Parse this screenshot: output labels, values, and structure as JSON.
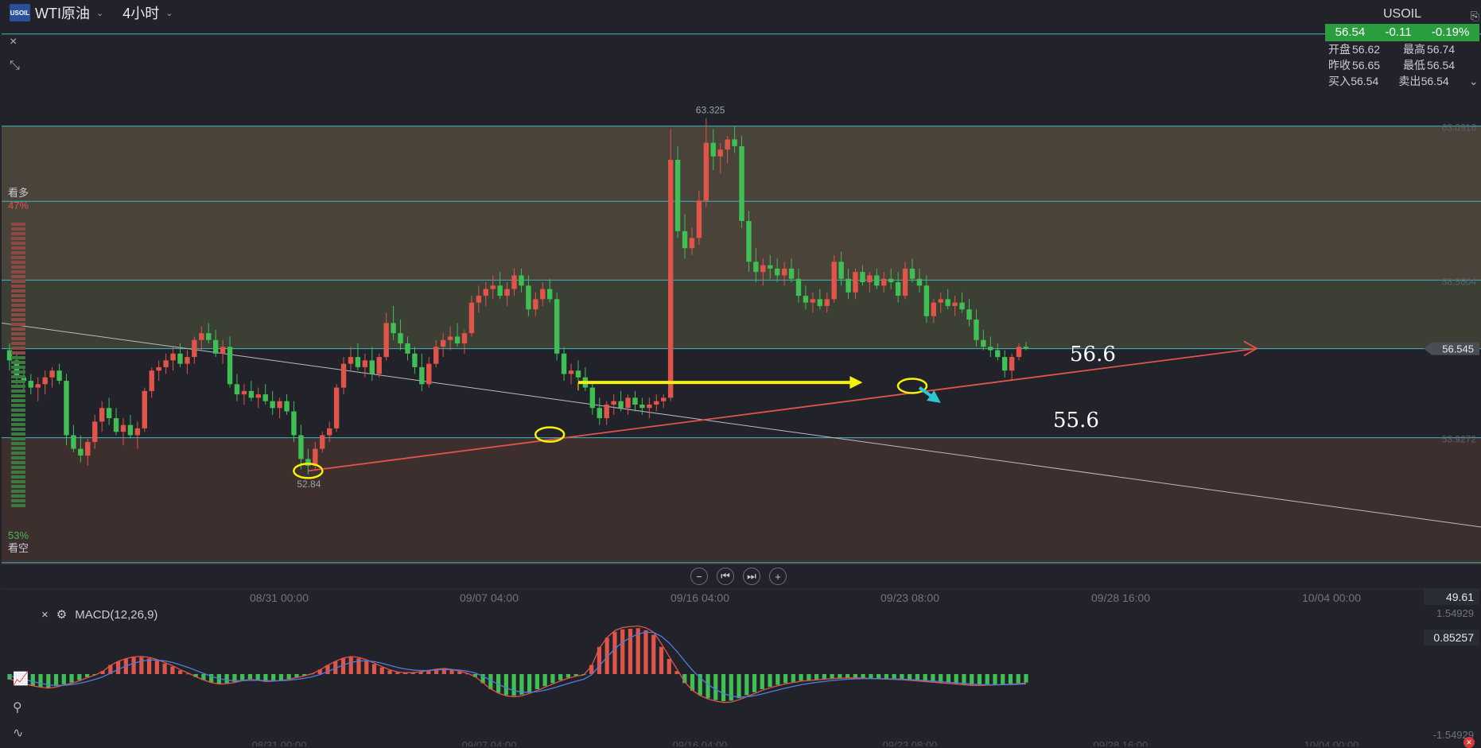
{
  "header": {
    "logo_text": "USOIL",
    "symbol": "WTI原油",
    "timeframe": "4小时",
    "close_icon": "×",
    "collapse_icon": "⤡"
  },
  "quote": {
    "title": "USOIL",
    "price": "56.54",
    "change": "-0.11",
    "change_pct": "-0.19%",
    "open_label": "开盘",
    "open": "56.62",
    "high_label": "最高",
    "high": "56.74",
    "prev_label": "昨收",
    "prev": "56.65",
    "low_label": "最低",
    "low": "56.54",
    "bid_label": "买入",
    "bid": "56.54",
    "ask_label": "卖出",
    "ask": "56.54",
    "expand_icon": "⌄",
    "accent_green": "#2a9d3f"
  },
  "sentiment": {
    "bull_label": "看多",
    "bull_pct": "47%",
    "bear_label": "看空",
    "bear_pct": "53%"
  },
  "chart_data": {
    "type": "candlestick",
    "timeframe": "4h",
    "x_labels": [
      "08/31 00:00",
      "09/07 04:00",
      "09/16 04:00",
      "09/23 08:00",
      "09/28 16:00",
      "10/04 00:00"
    ],
    "price_labels": [
      "63.0916",
      "58.5604",
      "56.545",
      "53.9272"
    ],
    "current_price": "56.545",
    "high_marker": "63.325",
    "low_marker": "52.84",
    "annotations": [
      "56.6",
      "55.6"
    ],
    "zones": [
      {
        "from": 58.5604,
        "to": 63.0916,
        "color": "#4a4339"
      },
      {
        "from": 56.545,
        "to": 58.5604,
        "color": "#3b3f34"
      },
      {
        "from": 50.2,
        "to": 53.9272,
        "color": "#3e2f2f"
      }
    ],
    "ylim": [
      50.2,
      66.8
    ],
    "candles": [
      [
        56.5,
        56.7,
        55.9,
        56.2
      ],
      [
        56.2,
        56.4,
        55.5,
        55.7
      ],
      [
        55.7,
        56.0,
        55.3,
        55.6
      ],
      [
        55.6,
        55.8,
        55.2,
        55.4
      ],
      [
        55.4,
        55.7,
        55.0,
        55.5
      ],
      [
        55.5,
        55.9,
        55.2,
        55.7
      ],
      [
        55.7,
        56.0,
        55.4,
        55.9
      ],
      [
        55.9,
        56.1,
        55.5,
        55.6
      ],
      [
        55.6,
        55.8,
        53.7,
        54.0
      ],
      [
        54.0,
        54.3,
        53.5,
        53.6
      ],
      [
        53.6,
        54.0,
        53.2,
        53.4
      ],
      [
        53.4,
        53.9,
        53.1,
        53.8
      ],
      [
        53.8,
        54.6,
        53.6,
        54.4
      ],
      [
        54.4,
        55.0,
        54.1,
        54.8
      ],
      [
        54.8,
        55.1,
        54.3,
        54.5
      ],
      [
        54.5,
        54.8,
        54.0,
        54.1
      ],
      [
        54.1,
        54.5,
        53.7,
        54.3
      ],
      [
        54.3,
        54.6,
        53.9,
        54.0
      ],
      [
        54.0,
        54.4,
        53.6,
        54.2
      ],
      [
        54.2,
        55.4,
        54.1,
        55.3
      ],
      [
        55.3,
        56.0,
        55.1,
        55.9
      ],
      [
        55.9,
        56.2,
        55.6,
        56.0
      ],
      [
        56.0,
        56.4,
        55.8,
        56.2
      ],
      [
        56.2,
        56.6,
        55.9,
        56.4
      ],
      [
        56.4,
        56.7,
        56.0,
        56.1
      ],
      [
        56.1,
        56.5,
        55.8,
        56.3
      ],
      [
        56.3,
        56.9,
        56.1,
        56.8
      ],
      [
        56.8,
        57.2,
        56.5,
        57.0
      ],
      [
        57.0,
        57.3,
        56.7,
        56.8
      ],
      [
        56.8,
        57.1,
        56.3,
        56.4
      ],
      [
        56.4,
        56.8,
        56.1,
        56.6
      ],
      [
        56.6,
        56.9,
        55.4,
        55.5
      ],
      [
        55.5,
        55.8,
        55.0,
        55.2
      ],
      [
        55.2,
        55.5,
        54.9,
        55.3
      ],
      [
        55.3,
        55.6,
        55.0,
        55.1
      ],
      [
        55.1,
        55.4,
        54.8,
        55.2
      ],
      [
        55.2,
        55.5,
        54.9,
        55.0
      ],
      [
        55.0,
        55.3,
        54.6,
        54.8
      ],
      [
        54.8,
        55.1,
        54.5,
        55.0
      ],
      [
        55.0,
        55.2,
        54.6,
        54.7
      ],
      [
        54.7,
        55.0,
        53.8,
        54.0
      ],
      [
        54.0,
        54.3,
        53.0,
        53.3
      ],
      [
        53.3,
        53.6,
        52.84,
        53.1
      ],
      [
        53.1,
        53.8,
        53.0,
        53.6
      ],
      [
        53.6,
        54.1,
        53.5,
        54.0
      ],
      [
        54.0,
        54.4,
        53.8,
        54.2
      ],
      [
        54.2,
        55.5,
        54.1,
        55.4
      ],
      [
        55.4,
        56.3,
        55.2,
        56.1
      ],
      [
        56.1,
        56.6,
        55.9,
        56.3
      ],
      [
        56.3,
        56.7,
        55.9,
        56.0
      ],
      [
        56.0,
        56.4,
        55.7,
        56.2
      ],
      [
        56.2,
        56.6,
        55.6,
        55.8
      ],
      [
        55.8,
        56.4,
        55.7,
        56.3
      ],
      [
        56.3,
        57.6,
        56.2,
        57.3
      ],
      [
        57.3,
        57.8,
        56.8,
        57.0
      ],
      [
        57.0,
        57.4,
        56.5,
        56.7
      ],
      [
        56.7,
        56.9,
        56.2,
        56.4
      ],
      [
        56.4,
        56.6,
        55.8,
        56.0
      ],
      [
        56.0,
        56.4,
        55.3,
        55.5
      ],
      [
        55.5,
        56.3,
        55.4,
        56.1
      ],
      [
        56.1,
        56.8,
        56.0,
        56.6
      ],
      [
        56.6,
        57.0,
        56.3,
        56.8
      ],
      [
        56.8,
        57.2,
        56.5,
        56.9
      ],
      [
        56.9,
        57.3,
        56.6,
        56.7
      ],
      [
        56.7,
        57.1,
        56.4,
        57.0
      ],
      [
        57.0,
        58.1,
        56.9,
        57.9
      ],
      [
        57.9,
        58.4,
        57.6,
        58.1
      ],
      [
        58.1,
        58.5,
        57.8,
        58.3
      ],
      [
        58.3,
        58.7,
        58.0,
        58.4
      ],
      [
        58.4,
        58.8,
        58.0,
        58.1
      ],
      [
        58.1,
        58.5,
        57.8,
        58.3
      ],
      [
        58.3,
        58.9,
        58.1,
        58.7
      ],
      [
        58.7,
        58.9,
        58.2,
        58.4
      ],
      [
        58.4,
        58.7,
        57.5,
        57.7
      ],
      [
        57.7,
        58.2,
        57.5,
        58.0
      ],
      [
        58.0,
        58.5,
        57.8,
        58.3
      ],
      [
        58.3,
        58.6,
        57.9,
        58.0
      ],
      [
        58.0,
        58.2,
        56.2,
        56.4
      ],
      [
        56.4,
        56.6,
        55.6,
        55.8
      ],
      [
        55.8,
        56.1,
        55.5,
        55.9
      ],
      [
        55.9,
        56.2,
        55.6,
        55.7
      ],
      [
        55.7,
        56.0,
        55.3,
        55.4
      ],
      [
        55.4,
        55.6,
        54.6,
        54.8
      ],
      [
        54.8,
        55.1,
        54.3,
        54.5
      ],
      [
        54.5,
        55.0,
        54.3,
        54.9
      ],
      [
        54.9,
        55.2,
        54.6,
        55.0
      ],
      [
        55.0,
        55.3,
        54.7,
        54.8
      ],
      [
        54.8,
        55.2,
        54.6,
        55.1
      ],
      [
        55.1,
        55.3,
        54.7,
        54.9
      ],
      [
        54.9,
        55.1,
        54.6,
        54.8
      ],
      [
        54.8,
        55.1,
        54.5,
        54.9
      ],
      [
        54.9,
        55.2,
        54.7,
        55.0
      ],
      [
        55.0,
        55.2,
        54.8,
        55.1
      ],
      [
        55.1,
        63.0,
        55.0,
        62.1
      ],
      [
        62.1,
        62.5,
        59.8,
        60.0
      ],
      [
        60.0,
        60.5,
        59.2,
        59.5
      ],
      [
        59.5,
        60.1,
        59.3,
        59.8
      ],
      [
        59.8,
        61.2,
        59.6,
        60.9
      ],
      [
        60.9,
        63.325,
        60.7,
        62.6
      ],
      [
        62.6,
        63.0,
        61.8,
        62.2
      ],
      [
        62.2,
        62.6,
        61.7,
        62.4
      ],
      [
        62.4,
        62.8,
        62.0,
        62.7
      ],
      [
        62.7,
        63.1,
        62.3,
        62.5
      ],
      [
        62.5,
        62.8,
        60.1,
        60.3
      ],
      [
        60.3,
        60.6,
        58.8,
        59.1
      ],
      [
        59.1,
        59.5,
        58.5,
        58.8
      ],
      [
        58.8,
        59.2,
        58.4,
        59.0
      ],
      [
        59.0,
        59.3,
        58.6,
        58.9
      ],
      [
        58.9,
        59.2,
        58.5,
        58.7
      ],
      [
        58.7,
        59.1,
        58.4,
        58.9
      ],
      [
        58.9,
        59.2,
        58.5,
        58.6
      ],
      [
        58.6,
        58.9,
        57.9,
        58.1
      ],
      [
        58.1,
        58.4,
        57.7,
        57.9
      ],
      [
        57.9,
        58.2,
        57.6,
        58.0
      ],
      [
        58.0,
        58.3,
        57.7,
        57.8
      ],
      [
        57.8,
        58.2,
        57.6,
        58.0
      ],
      [
        58.0,
        59.3,
        57.9,
        59.1
      ],
      [
        59.1,
        59.4,
        58.4,
        58.6
      ],
      [
        58.6,
        58.9,
        58.0,
        58.2
      ],
      [
        58.2,
        58.9,
        58.0,
        58.8
      ],
      [
        58.8,
        59.0,
        58.4,
        58.5
      ],
      [
        58.5,
        58.8,
        58.2,
        58.7
      ],
      [
        58.7,
        58.9,
        58.3,
        58.4
      ],
      [
        58.4,
        58.8,
        58.2,
        58.6
      ],
      [
        58.6,
        58.9,
        58.3,
        58.5
      ],
      [
        58.5,
        58.8,
        57.9,
        58.1
      ],
      [
        58.1,
        59.1,
        58.0,
        58.9
      ],
      [
        58.9,
        59.2,
        58.5,
        58.6
      ],
      [
        58.6,
        58.9,
        58.2,
        58.4
      ],
      [
        58.4,
        58.7,
        57.3,
        57.5
      ],
      [
        57.5,
        58.0,
        57.3,
        57.9
      ],
      [
        57.9,
        58.2,
        57.6,
        58.0
      ],
      [
        58.0,
        58.3,
        57.7,
        57.8
      ],
      [
        57.8,
        58.1,
        57.5,
        57.9
      ],
      [
        57.9,
        58.2,
        57.6,
        57.7
      ],
      [
        57.7,
        58.0,
        57.2,
        57.4
      ],
      [
        57.4,
        57.7,
        56.6,
        56.8
      ],
      [
        56.8,
        57.1,
        56.5,
        56.6
      ],
      [
        56.6,
        56.9,
        56.3,
        56.5
      ],
      [
        56.5,
        56.7,
        56.2,
        56.3
      ],
      [
        56.3,
        56.5,
        55.7,
        55.9
      ],
      [
        55.9,
        56.4,
        55.6,
        56.3
      ],
      [
        56.3,
        56.7,
        56.2,
        56.6
      ],
      [
        56.6,
        56.74,
        56.5,
        56.54
      ]
    ],
    "trendlines": [
      {
        "from": [
          0,
          57.3
        ],
        "to": [
          -1,
          51.3
        ],
        "color": "#b9bcc4"
      },
      {
        "from": [
          42,
          52.95
        ],
        "to": [
          -1,
          56.55
        ],
        "color": "#e0544a"
      }
    ],
    "arrows": [
      {
        "from": [
          80,
          55.55
        ],
        "to": [
          120,
          55.55
        ],
        "color": "#f5f10a"
      },
      {
        "from": [
          128,
          55.4
        ],
        "to": [
          131,
          54.95
        ],
        "color": "#2bc6d1"
      }
    ],
    "ellipses": [
      [
        42,
        52.95
      ],
      [
        76,
        54.02
      ],
      [
        127,
        55.45
      ]
    ],
    "macd": {
      "label": "MACD(12,26,9)",
      "levels": [
        "1.54929",
        "0.85257",
        "-1.54929"
      ],
      "readout": "49.61",
      "histogram": [
        -0.18,
        -0.25,
        -0.32,
        -0.38,
        -0.42,
        -0.45,
        -0.4,
        -0.34,
        -0.28,
        -0.2,
        -0.1,
        -0.02,
        0.1,
        0.3,
        0.42,
        0.5,
        0.55,
        0.56,
        0.52,
        0.45,
        0.35,
        0.25,
        0.12,
        0.02,
        -0.1,
        -0.2,
        -0.28,
        -0.32,
        -0.3,
        -0.26,
        -0.2,
        -0.16,
        -0.2,
        -0.24,
        -0.22,
        -0.2,
        -0.16,
        -0.1,
        -0.05,
        0.02,
        0.15,
        0.3,
        0.42,
        0.52,
        0.56,
        0.52,
        0.44,
        0.33,
        0.22,
        0.12,
        0.06,
        0.04,
        0.05,
        0.08,
        0.12,
        0.16,
        0.18,
        0.14,
        0.08,
        0.02,
        -0.1,
        -0.3,
        -0.5,
        -0.62,
        -0.7,
        -0.72,
        -0.68,
        -0.6,
        -0.5,
        -0.4,
        -0.3,
        -0.2,
        -0.12,
        -0.06,
        -0.02,
        0.3,
        0.9,
        1.2,
        1.4,
        1.48,
        1.5,
        1.52,
        1.45,
        1.3,
        0.9,
        0.5,
        0.1,
        -0.3,
        -0.55,
        -0.7,
        -0.8,
        -0.86,
        -0.9,
        -0.88,
        -0.8,
        -0.7,
        -0.6,
        -0.5,
        -0.42,
        -0.36,
        -0.3,
        -0.26,
        -0.22,
        -0.2,
        -0.18,
        -0.16,
        -0.14,
        -0.13,
        -0.12,
        -0.12,
        -0.13,
        -0.14,
        -0.15,
        -0.16,
        -0.17,
        -0.18,
        -0.2,
        -0.22,
        -0.24,
        -0.26,
        -0.28,
        -0.3,
        -0.32,
        -0.34,
        -0.36,
        -0.36,
        -0.35,
        -0.34,
        -0.33,
        -0.32,
        -0.3,
        -0.28
      ]
    }
  }
}
